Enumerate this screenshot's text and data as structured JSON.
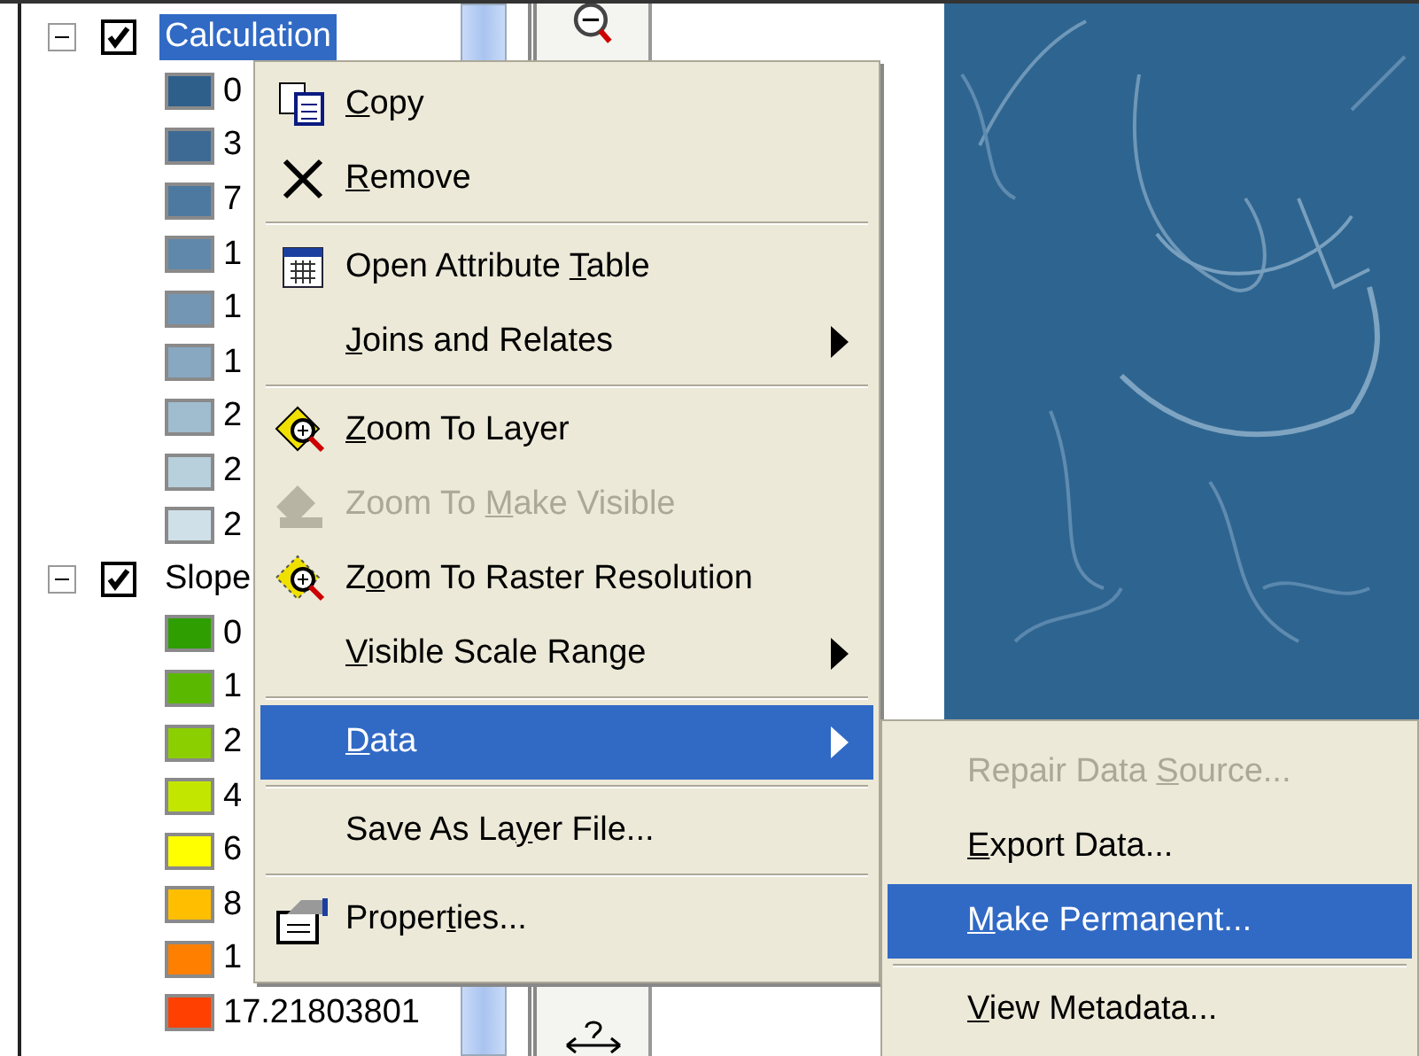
{
  "layers": [
    {
      "name": "Calculation",
      "checked": true,
      "selected": true,
      "expanded": true,
      "children": [
        {
          "label": "0",
          "color": "#2e5f8a"
        },
        {
          "label": "3",
          "color": "#3d6a94"
        },
        {
          "label": "7",
          "color": "#4d789f"
        },
        {
          "label": "1",
          "color": "#5f88ab"
        },
        {
          "label": "1",
          "color": "#7396b5"
        },
        {
          "label": "1",
          "color": "#88a8c2"
        },
        {
          "label": "2",
          "color": "#a0bccf"
        },
        {
          "label": "2",
          "color": "#b8cfdc"
        },
        {
          "label": "2",
          "color": "#cfe0e8"
        }
      ]
    },
    {
      "name": "Slope",
      "checked": true,
      "selected": false,
      "expanded": true,
      "children": [
        {
          "label": "0",
          "color": "#2e9e00"
        },
        {
          "label": "1",
          "color": "#5bb800"
        },
        {
          "label": "2",
          "color": "#8ccf00"
        },
        {
          "label": "4",
          "color": "#c3e600"
        },
        {
          "label": "6",
          "color": "#ffff00"
        },
        {
          "label": "8",
          "color": "#ffbf00"
        },
        {
          "label": "1",
          "color": "#ff8000"
        },
        {
          "label": "17.21803801",
          "color": "#ff4000"
        }
      ]
    }
  ],
  "context_menu": [
    {
      "kind": "item",
      "key": "C",
      "post": "opy",
      "disabled": false,
      "selected": false,
      "submenu": false
    },
    {
      "kind": "item",
      "key": "R",
      "post": "emove",
      "disabled": false,
      "selected": false,
      "submenu": false
    },
    {
      "kind": "separator"
    },
    {
      "kind": "item",
      "pre": "Open Attribute ",
      "key": "T",
      "post": "able",
      "disabled": false,
      "selected": false,
      "submenu": false
    },
    {
      "kind": "item",
      "key": "J",
      "post": "oins and Relates",
      "disabled": false,
      "selected": false,
      "submenu": true
    },
    {
      "kind": "separator"
    },
    {
      "kind": "item",
      "key": "Z",
      "post": "oom To Layer",
      "disabled": false,
      "selected": false,
      "submenu": false
    },
    {
      "kind": "item",
      "pre": "Zoom To ",
      "key": "M",
      "post": "ake Visible",
      "disabled": true,
      "selected": false,
      "submenu": false
    },
    {
      "kind": "item",
      "pre": "Z",
      "key": "o",
      "post": "om To Raster Resolution",
      "disabled": false,
      "selected": false,
      "submenu": false
    },
    {
      "kind": "item",
      "key": "V",
      "post": "isible Scale Range",
      "disabled": false,
      "selected": false,
      "submenu": true
    },
    {
      "kind": "separator"
    },
    {
      "kind": "item",
      "key": "D",
      "post": "ata",
      "disabled": false,
      "selected": true,
      "submenu": true
    },
    {
      "kind": "separator"
    },
    {
      "kind": "item",
      "pre": "Save As La",
      "key": "y",
      "post": "er File...",
      "disabled": false,
      "selected": false,
      "submenu": false
    },
    {
      "kind": "separator"
    },
    {
      "kind": "item",
      "pre": "Proper",
      "key": "t",
      "post": "ies...",
      "disabled": false,
      "selected": false,
      "submenu": false
    }
  ],
  "submenu": [
    {
      "kind": "item",
      "pre": "Repair Data ",
      "key": "S",
      "post": "ource...",
      "disabled": true,
      "selected": false
    },
    {
      "kind": "item",
      "key": "E",
      "post": "xport Data...",
      "disabled": false,
      "selected": false
    },
    {
      "kind": "item",
      "key": "M",
      "post": "ake Permanent...",
      "disabled": false,
      "selected": true
    },
    {
      "kind": "separator"
    },
    {
      "kind": "item",
      "key": "V",
      "post": "iew Metadata...",
      "disabled": false,
      "selected": false
    }
  ]
}
